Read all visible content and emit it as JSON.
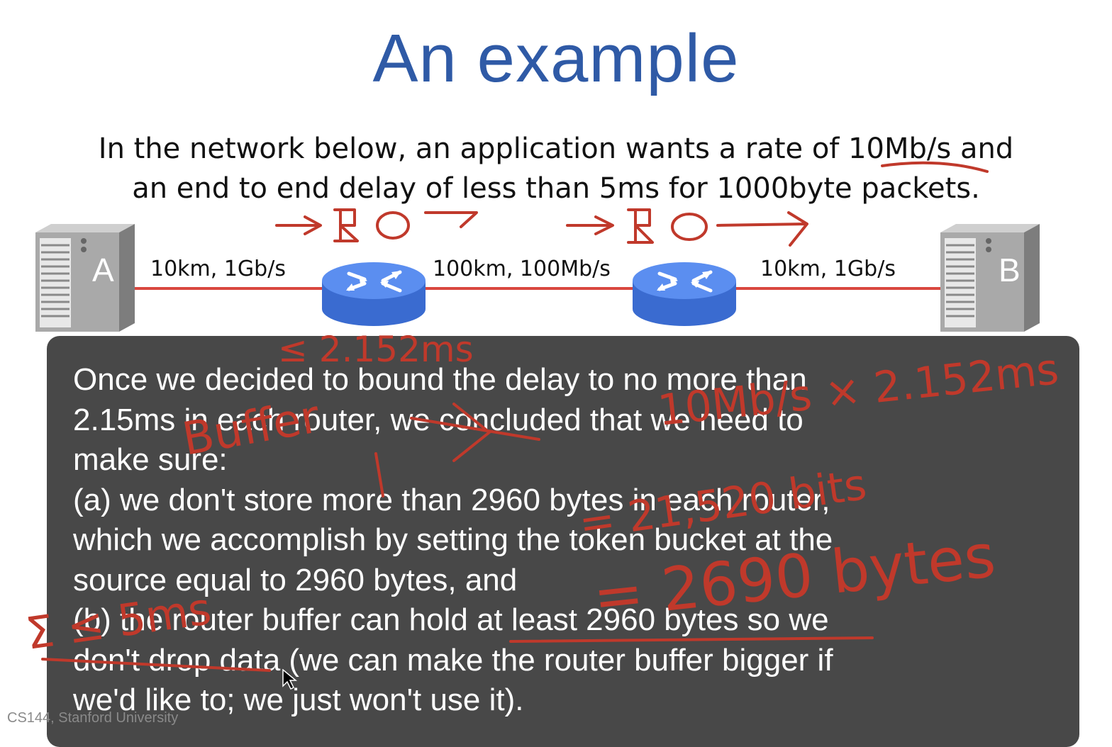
{
  "slide": {
    "title": "An example",
    "problem_line1": "In the network below, an application wants a rate of 10Mb/s and",
    "problem_line2": "an end to end delay of less than 5ms for 1000byte packets.",
    "footer": "CS144, Stanford University"
  },
  "network": {
    "host_a": "A",
    "host_b": "B",
    "link1_label": "10km, 1Gb/s",
    "link2_label": "100km, 100Mb/s",
    "link3_label": "10km, 1Gb/s",
    "link_color": "#d9473f",
    "router_color": "#4a7fe0"
  },
  "overlay": {
    "text": "Once we decided to bound the delay to no more than\n2.15ms in each router, we concluded that we need to\nmake sure:\n(a) we don't store more than 2960 bytes in each router,\nwhich we accomplish by setting the token bucket at the\nsource equal to 2960 bytes, and\n(b) the router buffer can hold at least 2960 bytes so we\ndon't drop data (we can make the router buffer bigger if\nwe'd like to; we just won't use it)."
  },
  "annotations": {
    "ink_color": "#c0392b",
    "delay_note": "≤ 2.152ms",
    "buffer_word": "Buffer",
    "rhs_expr": "10Mb/s × 2.152ms",
    "bits_result": "= 21,520 bits",
    "bytes_result": "= 2690 bytes",
    "total_delay": "Σ ≤ 5ms"
  },
  "title_color": "#2f5aa6"
}
